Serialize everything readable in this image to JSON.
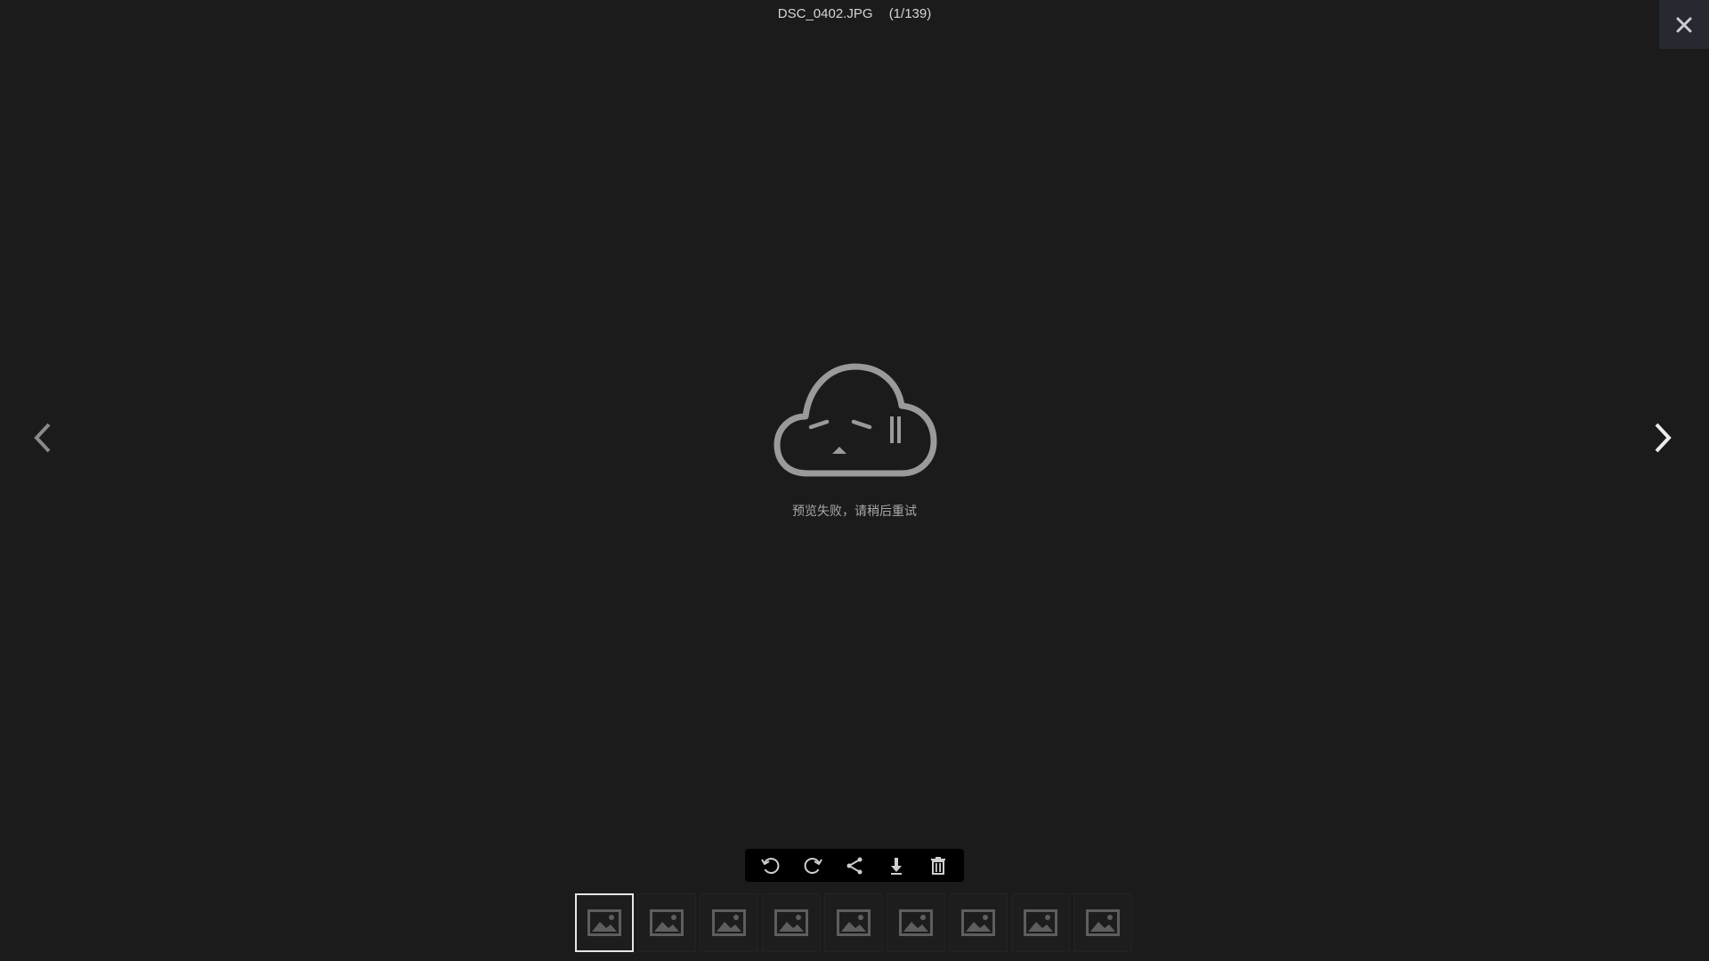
{
  "header": {
    "filename": "DSC_0402.JPG",
    "counter": "(1/139)"
  },
  "icons": {
    "close": "close-icon",
    "prev": "chevron-left-icon",
    "next": "chevron-right-icon",
    "error": "sad-cloud-icon",
    "thumbnail_placeholder": "image-placeholder-icon"
  },
  "preview": {
    "error_message": "预览失败，请稍后重试"
  },
  "toolbar": {
    "buttons": [
      {
        "name": "rotate-left",
        "icon": "rotate-left-icon"
      },
      {
        "name": "rotate-right",
        "icon": "rotate-right-icon"
      },
      {
        "name": "share",
        "icon": "share-icon"
      },
      {
        "name": "download",
        "icon": "download-icon"
      },
      {
        "name": "delete",
        "icon": "trash-icon"
      }
    ]
  },
  "thumbnails": {
    "count_visible": 9,
    "active_index": 0
  },
  "colors": {
    "background": "#1b1b1b",
    "toolbar_bg": "#000000",
    "icon_gray": "#8f8f8f",
    "text_light": "#d6d6d6",
    "active_border": "#e6e6e6"
  }
}
